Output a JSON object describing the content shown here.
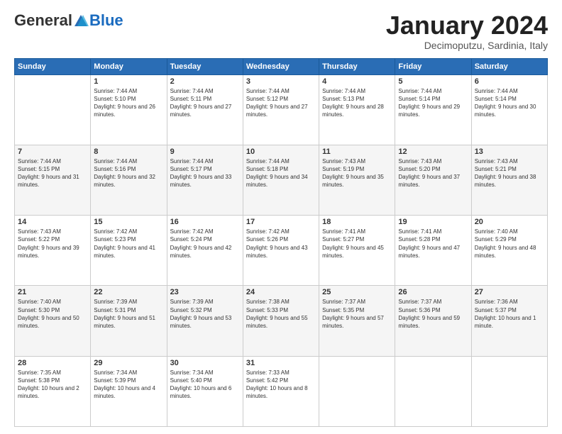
{
  "header": {
    "logo_general": "General",
    "logo_blue": "Blue",
    "month_title": "January 2024",
    "subtitle": "Decimoputzu, Sardinia, Italy"
  },
  "days_of_week": [
    "Sunday",
    "Monday",
    "Tuesday",
    "Wednesday",
    "Thursday",
    "Friday",
    "Saturday"
  ],
  "weeks": [
    [
      {
        "day": "",
        "sunrise": "",
        "sunset": "",
        "daylight": ""
      },
      {
        "day": "1",
        "sunrise": "Sunrise: 7:44 AM",
        "sunset": "Sunset: 5:10 PM",
        "daylight": "Daylight: 9 hours and 26 minutes."
      },
      {
        "day": "2",
        "sunrise": "Sunrise: 7:44 AM",
        "sunset": "Sunset: 5:11 PM",
        "daylight": "Daylight: 9 hours and 27 minutes."
      },
      {
        "day": "3",
        "sunrise": "Sunrise: 7:44 AM",
        "sunset": "Sunset: 5:12 PM",
        "daylight": "Daylight: 9 hours and 27 minutes."
      },
      {
        "day": "4",
        "sunrise": "Sunrise: 7:44 AM",
        "sunset": "Sunset: 5:13 PM",
        "daylight": "Daylight: 9 hours and 28 minutes."
      },
      {
        "day": "5",
        "sunrise": "Sunrise: 7:44 AM",
        "sunset": "Sunset: 5:14 PM",
        "daylight": "Daylight: 9 hours and 29 minutes."
      },
      {
        "day": "6",
        "sunrise": "Sunrise: 7:44 AM",
        "sunset": "Sunset: 5:14 PM",
        "daylight": "Daylight: 9 hours and 30 minutes."
      }
    ],
    [
      {
        "day": "7",
        "sunrise": "Sunrise: 7:44 AM",
        "sunset": "Sunset: 5:15 PM",
        "daylight": "Daylight: 9 hours and 31 minutes."
      },
      {
        "day": "8",
        "sunrise": "Sunrise: 7:44 AM",
        "sunset": "Sunset: 5:16 PM",
        "daylight": "Daylight: 9 hours and 32 minutes."
      },
      {
        "day": "9",
        "sunrise": "Sunrise: 7:44 AM",
        "sunset": "Sunset: 5:17 PM",
        "daylight": "Daylight: 9 hours and 33 minutes."
      },
      {
        "day": "10",
        "sunrise": "Sunrise: 7:44 AM",
        "sunset": "Sunset: 5:18 PM",
        "daylight": "Daylight: 9 hours and 34 minutes."
      },
      {
        "day": "11",
        "sunrise": "Sunrise: 7:43 AM",
        "sunset": "Sunset: 5:19 PM",
        "daylight": "Daylight: 9 hours and 35 minutes."
      },
      {
        "day": "12",
        "sunrise": "Sunrise: 7:43 AM",
        "sunset": "Sunset: 5:20 PM",
        "daylight": "Daylight: 9 hours and 37 minutes."
      },
      {
        "day": "13",
        "sunrise": "Sunrise: 7:43 AM",
        "sunset": "Sunset: 5:21 PM",
        "daylight": "Daylight: 9 hours and 38 minutes."
      }
    ],
    [
      {
        "day": "14",
        "sunrise": "Sunrise: 7:43 AM",
        "sunset": "Sunset: 5:22 PM",
        "daylight": "Daylight: 9 hours and 39 minutes."
      },
      {
        "day": "15",
        "sunrise": "Sunrise: 7:42 AM",
        "sunset": "Sunset: 5:23 PM",
        "daylight": "Daylight: 9 hours and 41 minutes."
      },
      {
        "day": "16",
        "sunrise": "Sunrise: 7:42 AM",
        "sunset": "Sunset: 5:24 PM",
        "daylight": "Daylight: 9 hours and 42 minutes."
      },
      {
        "day": "17",
        "sunrise": "Sunrise: 7:42 AM",
        "sunset": "Sunset: 5:26 PM",
        "daylight": "Daylight: 9 hours and 43 minutes."
      },
      {
        "day": "18",
        "sunrise": "Sunrise: 7:41 AM",
        "sunset": "Sunset: 5:27 PM",
        "daylight": "Daylight: 9 hours and 45 minutes."
      },
      {
        "day": "19",
        "sunrise": "Sunrise: 7:41 AM",
        "sunset": "Sunset: 5:28 PM",
        "daylight": "Daylight: 9 hours and 47 minutes."
      },
      {
        "day": "20",
        "sunrise": "Sunrise: 7:40 AM",
        "sunset": "Sunset: 5:29 PM",
        "daylight": "Daylight: 9 hours and 48 minutes."
      }
    ],
    [
      {
        "day": "21",
        "sunrise": "Sunrise: 7:40 AM",
        "sunset": "Sunset: 5:30 PM",
        "daylight": "Daylight: 9 hours and 50 minutes."
      },
      {
        "day": "22",
        "sunrise": "Sunrise: 7:39 AM",
        "sunset": "Sunset: 5:31 PM",
        "daylight": "Daylight: 9 hours and 51 minutes."
      },
      {
        "day": "23",
        "sunrise": "Sunrise: 7:39 AM",
        "sunset": "Sunset: 5:32 PM",
        "daylight": "Daylight: 9 hours and 53 minutes."
      },
      {
        "day": "24",
        "sunrise": "Sunrise: 7:38 AM",
        "sunset": "Sunset: 5:33 PM",
        "daylight": "Daylight: 9 hours and 55 minutes."
      },
      {
        "day": "25",
        "sunrise": "Sunrise: 7:37 AM",
        "sunset": "Sunset: 5:35 PM",
        "daylight": "Daylight: 9 hours and 57 minutes."
      },
      {
        "day": "26",
        "sunrise": "Sunrise: 7:37 AM",
        "sunset": "Sunset: 5:36 PM",
        "daylight": "Daylight: 9 hours and 59 minutes."
      },
      {
        "day": "27",
        "sunrise": "Sunrise: 7:36 AM",
        "sunset": "Sunset: 5:37 PM",
        "daylight": "Daylight: 10 hours and 1 minute."
      }
    ],
    [
      {
        "day": "28",
        "sunrise": "Sunrise: 7:35 AM",
        "sunset": "Sunset: 5:38 PM",
        "daylight": "Daylight: 10 hours and 2 minutes."
      },
      {
        "day": "29",
        "sunrise": "Sunrise: 7:34 AM",
        "sunset": "Sunset: 5:39 PM",
        "daylight": "Daylight: 10 hours and 4 minutes."
      },
      {
        "day": "30",
        "sunrise": "Sunrise: 7:34 AM",
        "sunset": "Sunset: 5:40 PM",
        "daylight": "Daylight: 10 hours and 6 minutes."
      },
      {
        "day": "31",
        "sunrise": "Sunrise: 7:33 AM",
        "sunset": "Sunset: 5:42 PM",
        "daylight": "Daylight: 10 hours and 8 minutes."
      },
      {
        "day": "",
        "sunrise": "",
        "sunset": "",
        "daylight": ""
      },
      {
        "day": "",
        "sunrise": "",
        "sunset": "",
        "daylight": ""
      },
      {
        "day": "",
        "sunrise": "",
        "sunset": "",
        "daylight": ""
      }
    ]
  ]
}
